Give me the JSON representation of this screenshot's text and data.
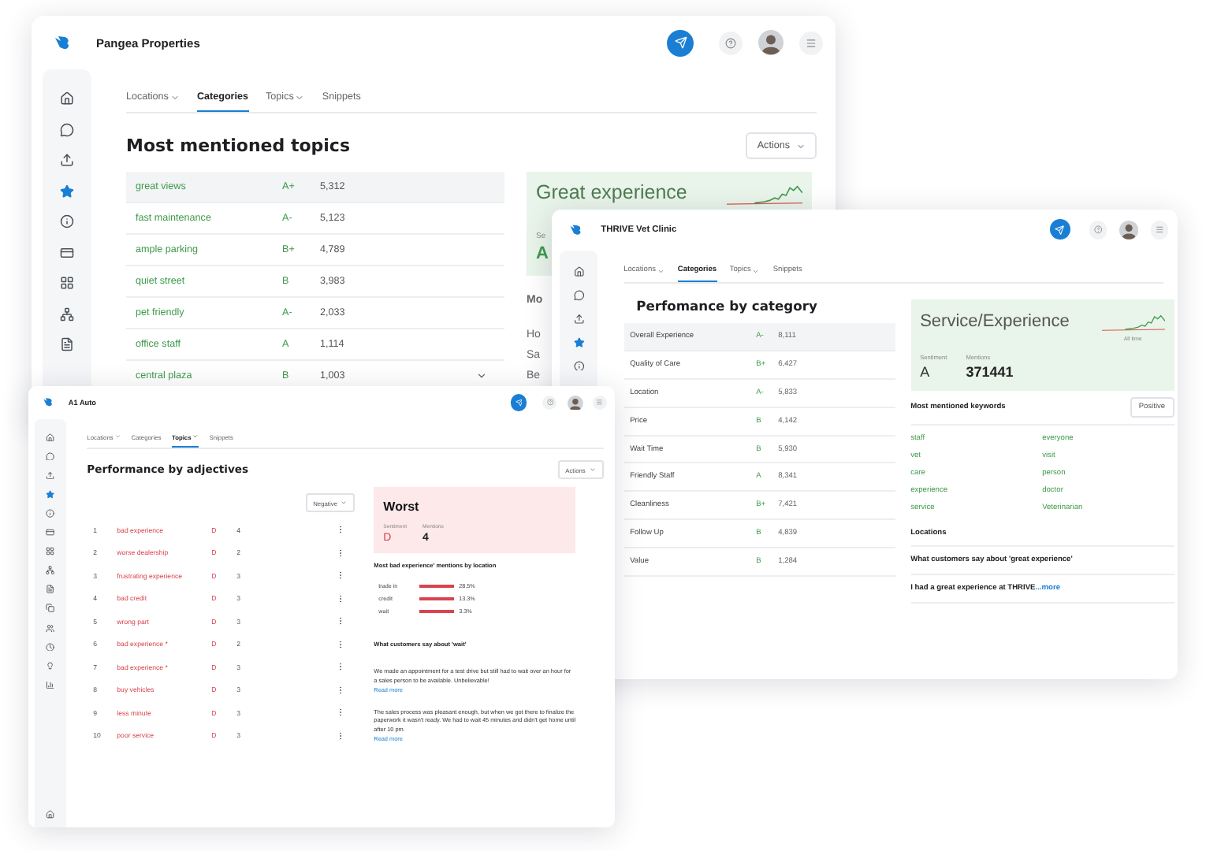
{
  "back_window": {
    "title": "Pangea Properties",
    "sidebar": [
      {
        "selected": false
      },
      {
        "selected": false
      },
      {
        "selected": false
      },
      {
        "selected": true
      },
      {
        "selected": false
      },
      {
        "selected": false
      },
      {
        "selected": false
      },
      {
        "selected": false
      },
      {
        "selected": false
      }
    ],
    "tabs": [
      {
        "label": "Locations",
        "dropdown": true,
        "selected": false
      },
      {
        "label": "Categories",
        "dropdown": false,
        "selected": true
      },
      {
        "label": "Topics",
        "dropdown": true,
        "selected": false
      },
      {
        "label": "Snippets",
        "dropdown": false,
        "selected": false
      }
    ],
    "heading": "Most mentioned topics",
    "actions": "Actions",
    "rows": [
      {
        "term": "great views",
        "grade": "A+",
        "count": "5,312",
        "selected": true
      },
      {
        "term": "fast maintenance",
        "grade": "A-",
        "count": "5,123",
        "selected": false
      },
      {
        "term": "ample parking",
        "grade": "B+",
        "count": "4,789",
        "selected": false
      },
      {
        "term": "quiet street",
        "grade": "B",
        "count": "3,983",
        "selected": false
      },
      {
        "term": "pet friendly",
        "grade": "A-",
        "count": "2,033",
        "selected": false
      },
      {
        "term": "office staff",
        "grade": "A",
        "count": "1,114",
        "selected": false
      },
      {
        "term": "central plaza",
        "grade": "B",
        "count": "1,003",
        "selected": false
      }
    ],
    "card": {
      "title": "Great experience",
      "sentiment_label": "Se",
      "sentiment": "A"
    },
    "side_heading": "Mo",
    "side_texts": [
      "Ho",
      "Sa",
      "Be"
    ]
  },
  "middle_window": {
    "title": "THRIVE Vet Clinic",
    "sidebar": [
      {
        "selected": false
      },
      {
        "selected": false
      },
      {
        "selected": false
      },
      {
        "selected": true
      },
      {
        "selected": false
      }
    ],
    "tabs": [
      {
        "label": "Locations",
        "dropdown": true,
        "selected": false
      },
      {
        "label": "Categories",
        "dropdown": false,
        "selected": true
      },
      {
        "label": "Topics",
        "dropdown": true,
        "selected": false
      },
      {
        "label": "Snippets",
        "dropdown": false,
        "selected": false
      }
    ],
    "heading": "Perfomance by category",
    "rows": [
      {
        "term": "Overall Experience",
        "grade": "A-",
        "count": "8,111",
        "selected": true
      },
      {
        "term": "Quality of Care",
        "grade": "B+",
        "count": "6,427",
        "selected": false
      },
      {
        "term": "Location",
        "grade": "A-",
        "count": "5,833",
        "selected": false
      },
      {
        "term": "Price",
        "grade": "B",
        "count": "4,142",
        "selected": false
      },
      {
        "term": "Wait Time",
        "grade": "B",
        "count": "5,930",
        "selected": false
      },
      {
        "term": "Friendly Staff",
        "grade": "A",
        "count": "8,341",
        "selected": false
      },
      {
        "term": "Cleanliness",
        "grade": "B+",
        "count": "7,421",
        "selected": false
      },
      {
        "term": "Follow Up",
        "grade": "B",
        "count": "4,839",
        "selected": false
      },
      {
        "term": "Value",
        "grade": "B",
        "count": "1,284",
        "selected": false
      }
    ],
    "card": {
      "title": "Service/Experience",
      "period": "All time",
      "sentiment_label": "Sentiment",
      "sentiment": "A",
      "mentions_label": "Mentions",
      "mentions": "371441"
    },
    "keywords_heading": "Most mentioned keywords",
    "filter": "Positive",
    "keywords": [
      "staff",
      "everyone",
      "vet",
      "visit",
      "care",
      "person",
      "experience",
      "doctor",
      "service",
      "Veterinarian"
    ],
    "locations": "Locations",
    "quote_heading": "What customers say about 'great experience'",
    "quote": "I had a great experience at THRIVE",
    "more": "...more"
  },
  "front_window": {
    "title": "A1 Auto",
    "sidebar": [
      {
        "selected": false
      },
      {
        "selected": false
      },
      {
        "selected": false
      },
      {
        "selected": true
      },
      {
        "selected": false
      },
      {
        "selected": false
      },
      {
        "selected": false
      },
      {
        "selected": false
      },
      {
        "selected": false
      },
      {
        "selected": false
      },
      {
        "selected": false
      },
      {
        "selected": false
      },
      {
        "selected": false
      },
      {
        "selected": false
      },
      {
        "selected": false,
        "bottom": true
      }
    ],
    "tabs": [
      {
        "label": "Locations",
        "dropdown": true,
        "selected": false
      },
      {
        "label": "Categories",
        "dropdown": false,
        "selected": false
      },
      {
        "label": "Topics",
        "dropdown": true,
        "selected": true
      },
      {
        "label": "Snippets",
        "dropdown": false,
        "selected": false
      }
    ],
    "heading": "Performance by adjectives",
    "actions": "Actions",
    "filter": "Negative",
    "rows": [
      {
        "rank": "1",
        "term": "bad experience",
        "grade": "D",
        "count": "4"
      },
      {
        "rank": "2",
        "term": "worse dealership",
        "grade": "D",
        "count": "2"
      },
      {
        "rank": "3",
        "term": "frustrating experience",
        "grade": "D",
        "count": "3"
      },
      {
        "rank": "4",
        "term": "bad credit",
        "grade": "D",
        "count": "3"
      },
      {
        "rank": "5",
        "term": "wrong part",
        "grade": "D",
        "count": "3"
      },
      {
        "rank": "6",
        "term": "bad experience *",
        "grade": "D",
        "count": "2"
      },
      {
        "rank": "7",
        "term": "bad experience *",
        "grade": "D",
        "count": "3"
      },
      {
        "rank": "8",
        "term": "buy vehicles",
        "grade": "D",
        "count": "3"
      },
      {
        "rank": "9",
        "term": "less minute",
        "grade": "D",
        "count": "3"
      },
      {
        "rank": "10",
        "term": "poor service",
        "grade": "D",
        "count": "3"
      }
    ],
    "card": {
      "title": "Worst",
      "sentiment_label": "Sentiment",
      "sentiment": "D",
      "mentions_label": "Mentions",
      "mentions": "4"
    },
    "locations_heading": "Most bad experience' mentions by location",
    "locations": [
      {
        "name": "trade in",
        "share": "28.5%"
      },
      {
        "name": "credit",
        "share": "13.3%"
      },
      {
        "name": "wait",
        "share": "3.3%"
      }
    ],
    "quote_heading": "What customers say about 'wait'",
    "quotes": [
      {
        "text": "We made an appointment for a test drive but still had to wait over an hour for a sales person to be available. Unbelievable!",
        "link": "Read more"
      },
      {
        "text": "The sales process was pleasant enough, but when we got there to finalize the paperwork it wasn't ready. We had to wait 45 minutes and didn't get home until after 10 pm.",
        "link": "Read more"
      }
    ]
  }
}
